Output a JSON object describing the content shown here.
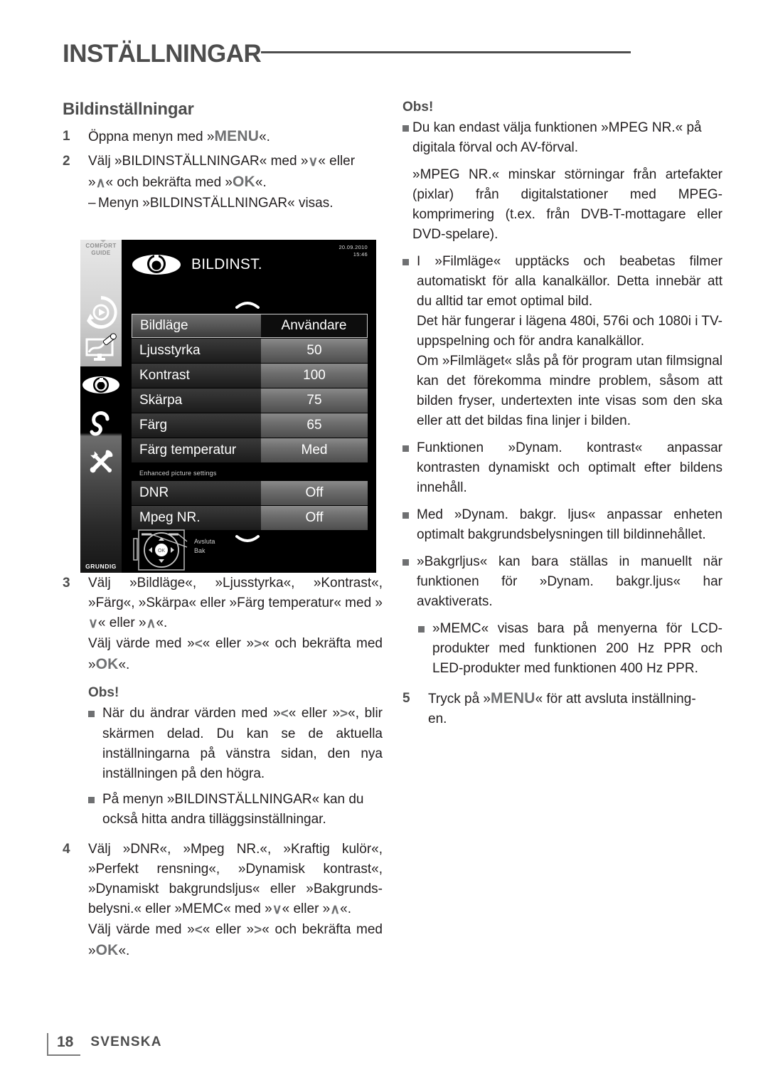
{
  "header": {
    "title": "INSTÄLLNINGAR"
  },
  "left": {
    "section_title": "Bildinställningar",
    "steps": [
      {
        "num": "1",
        "lines": [
          "Öppna menyn med »MENU«."
        ]
      },
      {
        "num": "2",
        "lines": [
          "Välj »BILDINSTÄLLNINGAR« med »∨« eller »∧« och bekräfta med »OK«.",
          "– Menyn »BILDINSTÄLLNINGAR« visas."
        ]
      }
    ],
    "step3": {
      "num": "3",
      "line1": "Välj »Bildläge«, »Ljusstyrka«, »Kontrast«, »Färg«, »Skärpa« eller »Färg temperatur« med »∨« eller »∧«.",
      "line2": "Välj värde med »<« eller »>« och bekräfta med »OK«."
    },
    "obs_label": "Obs!",
    "obs_items": [
      "När du ändrar värden med »<« eller »>«, blir skärmen delad. Du kan se de aktuella inställningarna på vänstra sidan, den nya inställningen på den högra.",
      "På menyn »BILDINSTÄLLNINGAR« kan du också hitta andra tilläggsinställningar."
    ],
    "step4": {
      "num": "4",
      "line1": "Välj »DNR«, »Mpeg NR.«, »Kraftig kulör«, »Perfekt rensning«, »Dynamisk kontrast«, »Dynamiskt bakgrundsljus« eller »Bakgrunds-belysni.« eller »MEMC« med »∨« eller »∧«.",
      "line2": "Välj värde med »<« eller »>« och bekräfta med »OK«."
    }
  },
  "right": {
    "obs_label": "Obs!",
    "items": [
      {
        "paragraphs": [
          "Du kan endast välja funktionen »MPEG NR.« på digitala förval och AV-förval.",
          "»MPEG NR.« minskar störningar från artefakter (pixlar) från digitalstationer med MPEG-komprimering (t.ex. från DVB-T-mottagare eller DVD-spelare)."
        ]
      },
      {
        "paragraphs": [
          "I »Filmläge« upptäcks och beabetas filmer automatiskt för alla kanalkällor. Detta innebär att du alltid tar emot optimal bild.",
          "Det här fungerar i lägena 480i, 576i och 1080i i TV-uppspelning och för andra kanalkällor.",
          "Om »Filmläget« slås på för program utan filmsignal kan det förekomma mindre problem, såsom att bilden fryser, undertexten inte visas som den ska eller att det bildas fina linjer i bilden."
        ]
      },
      {
        "paragraphs": [
          "Funktionen »Dynam. kontrast« anpassar kontrasten dynamiskt och optimalt efter bildens innehåll."
        ]
      },
      {
        "paragraphs": [
          "Med »Dynam. bakgr. ljus« anpassar enheten optimalt bakgrundsbelysningen till bildinnehållet."
        ]
      },
      {
        "paragraphs": [
          "»Bakgrljus« kan bara ställas in manuellt när funktionen för »Dynam. bakgr.ljus« har avaktiverats."
        ]
      },
      {
        "paragraphs": [
          "»MEMC« visas bara på menyerna för LCD-produkter med funktionen 200 Hz PPR och LED-produkter med funktionen 400 Hz PPR."
        ]
      }
    ],
    "step5": {
      "num": "5",
      "text": "Tryck på »MENU« för att avsluta inställningen."
    }
  },
  "tv": {
    "sidebar_label_line1": "COMFORT",
    "sidebar_label_line2": "GUIDE",
    "brand": "GRUNDIG",
    "date": "20.09.2010",
    "time": "15:46",
    "menu_title": "BILDINST.",
    "rows": [
      {
        "label": "Bildläge",
        "value": "Användare",
        "selected": true
      },
      {
        "label": "Ljusstyrka",
        "value": "50",
        "selected": false
      },
      {
        "label": "Kontrast",
        "value": "100",
        "selected": false
      },
      {
        "label": "Skärpa",
        "value": "75",
        "selected": false
      },
      {
        "label": "Färg",
        "value": "65",
        "selected": false
      },
      {
        "label": "Färg temperatur",
        "value": "Med",
        "selected": false
      }
    ],
    "section_note": "Enhanced picture settings",
    "rows2": [
      {
        "label": "DNR",
        "value": "Off",
        "selected": false
      },
      {
        "label": "Mpeg NR.",
        "value": "Off",
        "selected": false
      }
    ],
    "foot_exit": "Avsluta",
    "foot_back": "Bak",
    "ok_label": "OK"
  },
  "footer": {
    "page_number": "18",
    "language": "SVENSKA"
  },
  "colors": {
    "ink": "#231f20",
    "grey": "#4d4d4d",
    "bullet": "#6f7072"
  }
}
